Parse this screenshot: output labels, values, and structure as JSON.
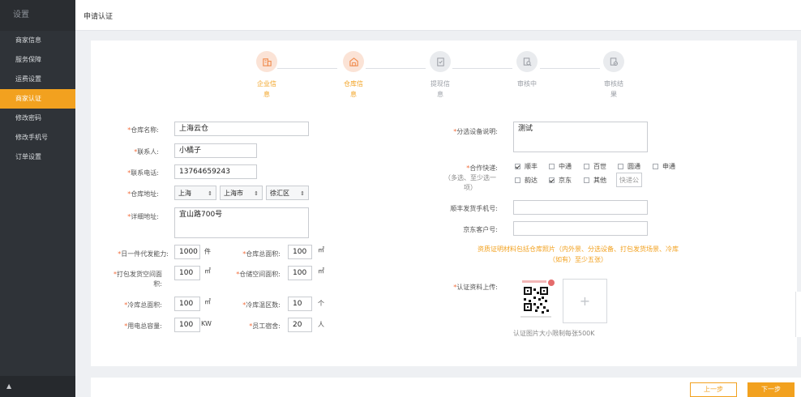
{
  "sidebar": {
    "title": "设置",
    "items": [
      {
        "label": "商家信息"
      },
      {
        "label": "服务保障"
      },
      {
        "label": "运费设置"
      },
      {
        "label": "商家认证"
      },
      {
        "label": "修改密码"
      },
      {
        "label": "修改手机号"
      },
      {
        "label": "订单设置"
      }
    ],
    "active_index": 3,
    "bottom_glyph": "▲"
  },
  "header": {
    "title": "申请认证"
  },
  "steps": [
    {
      "label": "企业信\n息",
      "active": true,
      "icon": "building-icon"
    },
    {
      "label": "仓库信\n息",
      "active": true,
      "icon": "warehouse-icon"
    },
    {
      "label": "提现信\n息",
      "active": false,
      "icon": "checklist-icon"
    },
    {
      "label": "审核中",
      "active": false,
      "icon": "magnifier-doc-icon"
    },
    {
      "label": "审核结\n果",
      "active": false,
      "icon": "result-doc-icon"
    }
  ],
  "form": {
    "warehouse_name": {
      "label": "仓库名称:",
      "value": "上海云仓"
    },
    "contact": {
      "label": "联系人:",
      "value": "小橘子"
    },
    "phone": {
      "label": "联系电话:",
      "value": "13764659243"
    },
    "address": {
      "label": "仓库地址:",
      "province": "上海",
      "city": "上海市",
      "district": "徐汇区"
    },
    "detail_address": {
      "label": "详细地址:",
      "value": "宜山路700号"
    },
    "daily_capacity": {
      "label": "日一件代发能力:",
      "value": "1000",
      "unit": "件"
    },
    "total_area": {
      "label": "仓库总面积:",
      "value": "100",
      "unit": "㎡"
    },
    "pack_area": {
      "label": "打包发货空间面\n积:",
      "value": "100",
      "unit": "㎡"
    },
    "storage_area": {
      "label": "仓储空间面积:",
      "value": "100",
      "unit": "㎡"
    },
    "cold_area": {
      "label": "冷库总面积:",
      "value": "100",
      "unit": "㎡"
    },
    "temp_zones": {
      "label": "冷库温区数:",
      "value": "10",
      "unit": "个"
    },
    "power": {
      "label": "用电总容量:",
      "value": "100",
      "unit": "KW"
    },
    "staff": {
      "label": "员工宿舍:",
      "value": "20",
      "unit": "人"
    },
    "sorting_desc": {
      "label": "分选设备说明:",
      "value": "测试"
    },
    "express": {
      "label": "合作快递:",
      "sub": "（多选、至少选一\n项）",
      "options": [
        {
          "name": "顺丰",
          "checked": true
        },
        {
          "name": "中通",
          "checked": false
        },
        {
          "name": "百世",
          "checked": false
        },
        {
          "name": "圆通",
          "checked": false
        },
        {
          "name": "申通",
          "checked": false
        },
        {
          "name": "韵达",
          "checked": false
        },
        {
          "name": "京东",
          "checked": true
        },
        {
          "name": "其他",
          "checked": false
        }
      ],
      "other_placeholder": "快递公"
    },
    "sf_phone": {
      "label": "顺丰发货手机号:",
      "value": ""
    },
    "jd_customer": {
      "label": "京东客户号:",
      "value": ""
    },
    "note": "资质证明材料包括仓库照片（内外景、分选设备、打包发货场景、冷库\n（如有）至少五张）",
    "upload": {
      "label": "认证资料上传:",
      "hint": "认证图片大小限制每张500K",
      "plus": "+"
    }
  },
  "buttons": {
    "prev": "上一步",
    "next": "下一步"
  },
  "colors": {
    "accent": "#f2a11f",
    "sidebar_bg": "#2f3338",
    "required": "#f26b3a"
  }
}
